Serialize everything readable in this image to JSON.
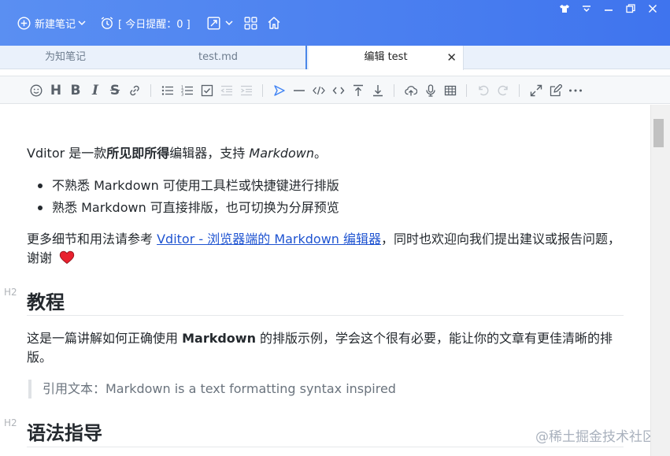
{
  "titlebar": {
    "new_note_label": "新建笔记",
    "reminder_label": "[ 今日提醒：0 ]",
    "icons": [
      "plus-circle-icon",
      "chevron-down-icon",
      "alarm-clock-icon",
      "resize-icon",
      "grid-icon",
      "home-icon",
      "tshirt-icon",
      "dropdown-arrow-icon",
      "minimize-icon",
      "restore-icon",
      "close-icon"
    ]
  },
  "tabs": [
    {
      "label": "为知笔记"
    },
    {
      "label": "test.md"
    },
    {
      "label": "编辑 test"
    }
  ],
  "content": {
    "intro_prefix": "Vditor 是一款",
    "intro_bold": "所见即所得",
    "intro_mid": "编辑器，支持 ",
    "intro_italic": "Markdown",
    "intro_suffix": "。",
    "bullets": [
      "不熟悉 Markdown 可使用工具栏或快捷键进行排版",
      "熟悉 Markdown 可直接排版，也可切换为分屏预览"
    ],
    "more_prefix": "更多细节和用法请参考 ",
    "more_link": "Vditor - 浏览器端的 Markdown 编辑器",
    "more_suffix": "，同时也欢迎向我们提出建议或报告问题，",
    "more_line2": "谢谢",
    "h2_tag": "H2",
    "heading1": "教程",
    "tutorial_prefix": "这是一篇讲解如何正确使用 ",
    "tutorial_bold": "Markdown",
    "tutorial_suffix": " 的排版示例，学会这个很有必要，能让你的文章有更佳清晰的排",
    "tutorial_line2": "版。",
    "quote": "引用文本：Markdown is a text formatting syntax inspired",
    "heading2": "语法指导"
  },
  "watermark": "@稀土掘金技术社区",
  "colors": {
    "titlebar": "#4a80f0",
    "accent": "#4a86e8",
    "link": "#1f54d1",
    "heart": "#e8212e"
  }
}
